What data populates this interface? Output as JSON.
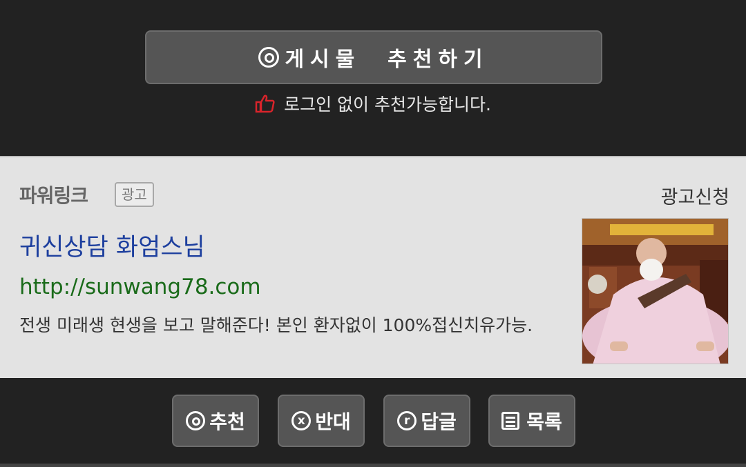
{
  "recommend": {
    "button_label": "게시물  추천하기",
    "login_note": "로그인 없이 추천가능합니다."
  },
  "ad": {
    "brand": "파워링크",
    "badge": "광고",
    "apply_link": "광고신청",
    "title": "귀신상담 화엄스님",
    "url": "http://sunwang78.com",
    "description": "전생 미래생 현생을 보고 말해준다! 본인 환자없이 100%접신치유가능.",
    "thumbnail_icon": "monk-photo"
  },
  "bottom": {
    "buttons": [
      {
        "label": "추천",
        "icon": "circle-o-icon"
      },
      {
        "label": "반대",
        "icon": "circle-x-icon",
        "glyph": "x"
      },
      {
        "label": "답글",
        "icon": "circle-r-icon",
        "glyph": "r"
      },
      {
        "label": "목록",
        "icon": "list-icon"
      }
    ]
  },
  "colors": {
    "background": "#222222",
    "button": "#555555",
    "ad_background": "#e3e3e3",
    "ad_title": "#1d3f9e",
    "ad_url": "#1a6b1a",
    "thumb_icon": "#d9242b"
  }
}
